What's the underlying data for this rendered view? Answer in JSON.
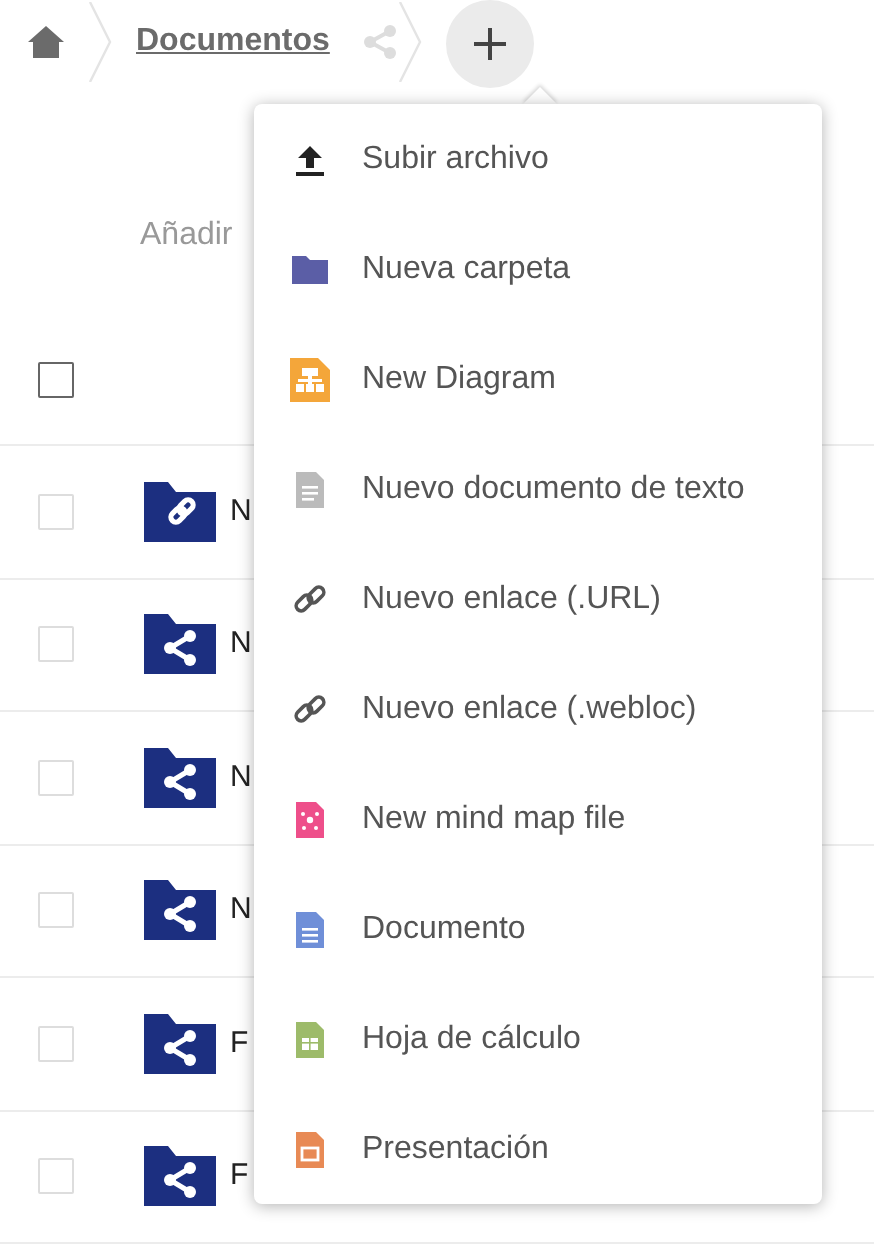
{
  "breadcrumb": {
    "items": [
      {
        "label": "Documentos",
        "shared": true
      }
    ]
  },
  "new_menu": {
    "open": true,
    "items": [
      {
        "kind": "upload",
        "label": "Subir archivo"
      },
      {
        "kind": "folder",
        "label": "Nueva carpeta"
      },
      {
        "kind": "diagram",
        "label": "New Diagram"
      },
      {
        "kind": "text",
        "label": "Nuevo documento de texto"
      },
      {
        "kind": "link",
        "label": "Nuevo enlace (.URL)"
      },
      {
        "kind": "link",
        "label": "Nuevo enlace (.webloc)"
      },
      {
        "kind": "mindmap",
        "label": "New mind map file"
      },
      {
        "kind": "document",
        "label": "Documento"
      },
      {
        "kind": "spreadsheet",
        "label": "Hoja de cálculo"
      },
      {
        "kind": "presentation",
        "label": "Presentación"
      }
    ]
  },
  "hint_text": "Añadir",
  "table": {
    "select_all": {
      "checked": false
    },
    "rows": [
      {
        "kind": "link-folder",
        "name": "N",
        "selected": false
      },
      {
        "kind": "shared-folder",
        "name": "N",
        "selected": false
      },
      {
        "kind": "shared-folder",
        "name": "N",
        "selected": false
      },
      {
        "kind": "shared-folder",
        "name": "N",
        "selected": false
      },
      {
        "kind": "shared-folder",
        "name": "F",
        "selected": false
      },
      {
        "kind": "shared-folder",
        "name": "F",
        "selected": false
      }
    ]
  }
}
